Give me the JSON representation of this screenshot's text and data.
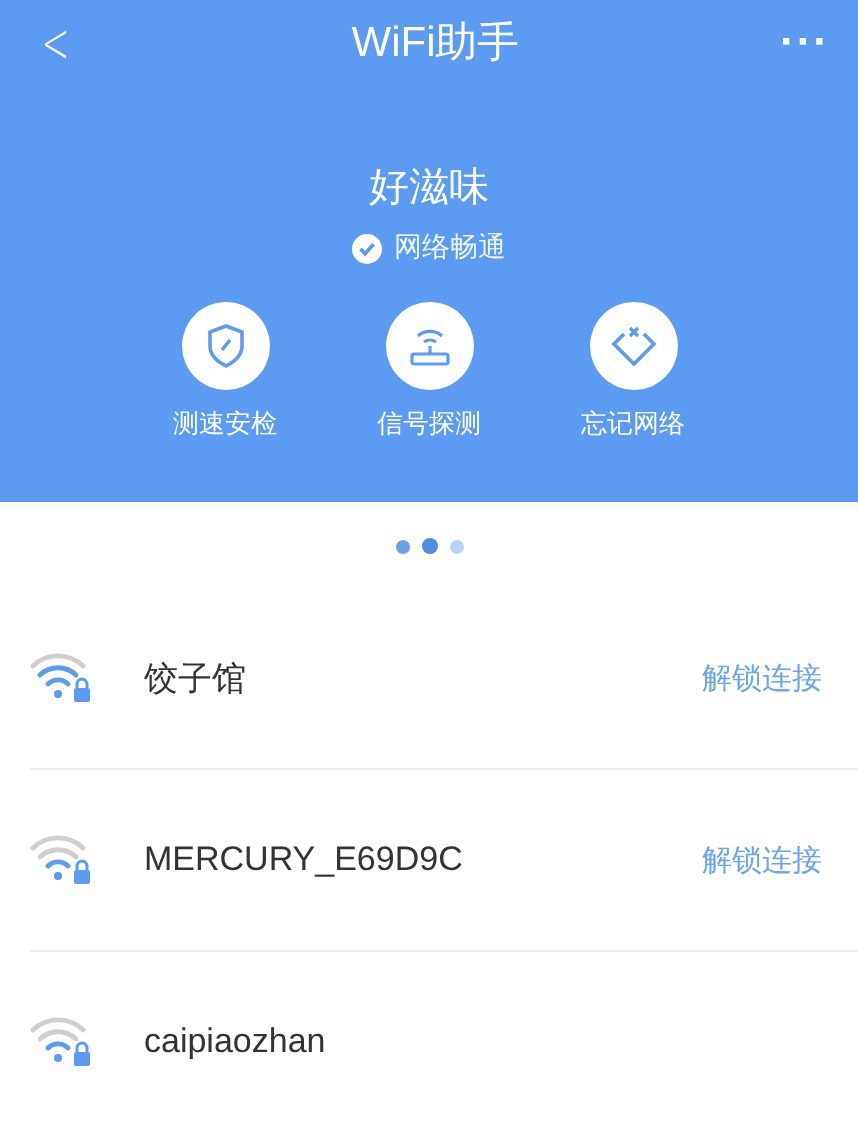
{
  "nav_bar": {
    "back": "<",
    "title": "WiFi助手",
    "more": "···"
  },
  "network": {
    "name": "好滋味",
    "status": "网络畅通",
    "connected": true
  },
  "actions": [
    {
      "label": "测速安检",
      "kind": "shield"
    },
    {
      "label": "信号探测",
      "kind": "router"
    },
    {
      "label": "忘记网络",
      "kind": "diamond"
    }
  ],
  "pager": [
    {
      "selected": false
    },
    {
      "selected": true
    },
    {
      "selected": false
    }
  ],
  "wifi_list": [
    {
      "name": "饺子馆",
      "strong_signal": true,
      "locked": true,
      "action": "解锁连接"
    },
    {
      "name": "MERCURY_E69D9C",
      "strong_signal": false,
      "locked": true,
      "action": "解锁连接"
    },
    {
      "name": "caipiaozhan",
      "strong_signal": false,
      "locked": true
    }
  ]
}
